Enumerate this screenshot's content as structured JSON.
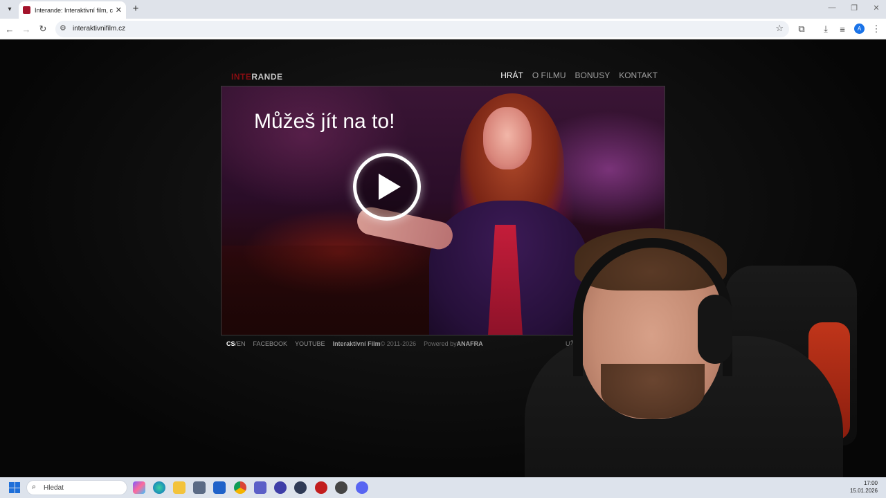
{
  "browser": {
    "tab_title": "Interande: Interaktivní film, co s",
    "url": "interaktivnifilm.cz",
    "profile_initial": "A"
  },
  "site": {
    "logo_part1": "INTE",
    "logo_part2": "RANDE",
    "nav": [
      "HRÁT",
      "O FILMU",
      "BONUSY",
      "KONTAKT"
    ],
    "hero_title": "Můžeš jít na to!",
    "footer": {
      "lang_cs": "CS",
      "lang_en": "/EN",
      "facebook": "FACEBOOK",
      "youtube": "YOUTUBE",
      "film": "Interaktivní Film",
      "copyright": " © 2011-2026",
      "powered": "Powered by ",
      "anafra": "ANAFRA",
      "right": "UŽ PROBĚ"
    }
  },
  "taskbar": {
    "search_placeholder": "Hledat",
    "time": "17:00",
    "date": "15.01.2026"
  },
  "colors": {
    "logo_accent": "#8a0d12",
    "page_bg": "#0a0a0a",
    "dress_red": "#c41d3a"
  }
}
